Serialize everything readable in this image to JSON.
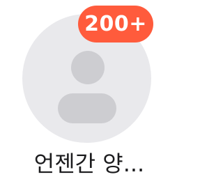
{
  "contact": {
    "avatar_icon": "person-placeholder-icon",
    "badge_count": "200+",
    "name": "언젠간 양..."
  },
  "colors": {
    "badge_background": "#ff5b3c",
    "badge_text": "#ffffff",
    "avatar_background": "#e9e9ec",
    "avatar_silhouette": "#cdcdd1",
    "name_text": "#1c1c1e"
  }
}
